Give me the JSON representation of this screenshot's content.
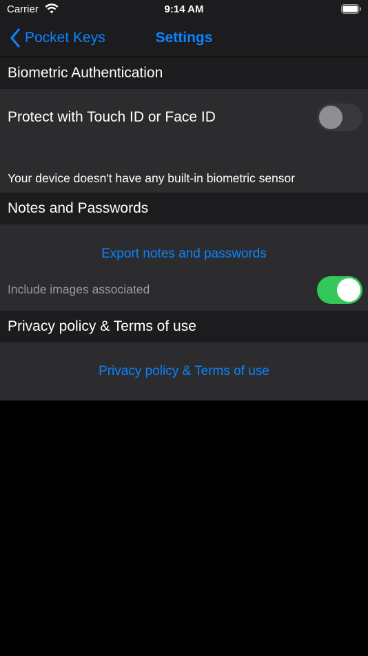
{
  "status_bar": {
    "carrier": "Carrier",
    "time": "9:14 AM"
  },
  "navbar": {
    "back_label": "Pocket Keys",
    "title": "Settings"
  },
  "sections": {
    "biometric": {
      "header": "Biometric Authentication",
      "toggle_label": "Protect with Touch ID or Face ID",
      "toggle_on": false,
      "footnote": "Your device doesn't have any built-in biometric sensor"
    },
    "notes": {
      "header": "Notes and Passwords",
      "export_label": "Export notes and passwords",
      "include_images_label": "Include images associated",
      "include_images_on": true
    },
    "privacy": {
      "header": "Privacy policy & Terms of use",
      "link_label": "Privacy policy & Terms of use"
    }
  },
  "colors": {
    "accent": "#0a84ff",
    "toggle_on": "#34c759",
    "background": "#000000",
    "header_bg": "#1c1c1e",
    "cell_bg": "#2c2c2e"
  }
}
